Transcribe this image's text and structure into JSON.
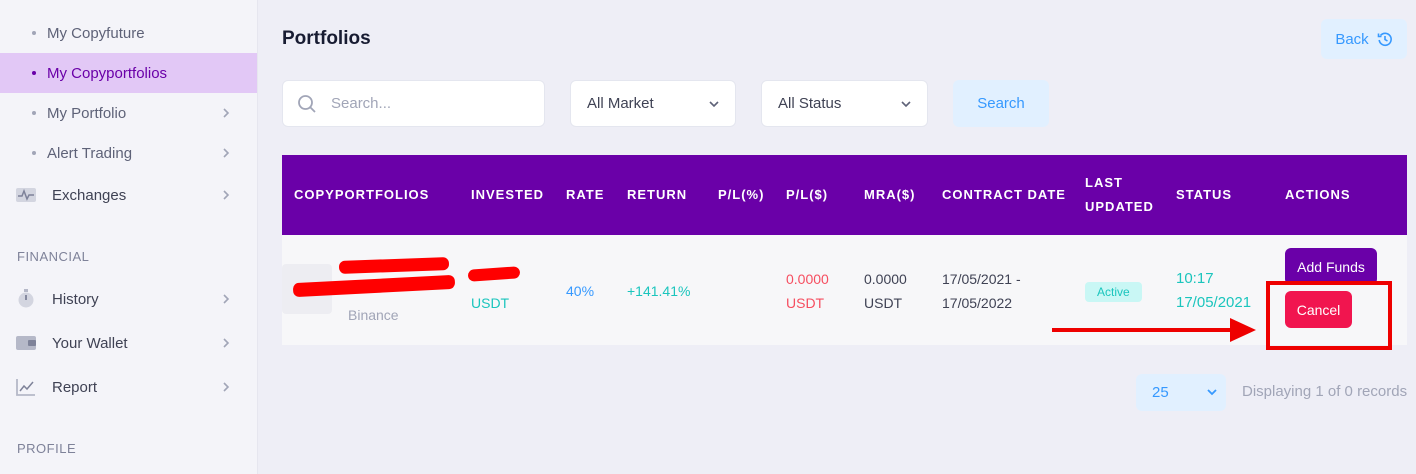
{
  "sidebar": {
    "sub_items": [
      {
        "label": "My Copyfuture"
      },
      {
        "label": "My Copyportfolios"
      },
      {
        "label": "My Portfolio"
      },
      {
        "label": "Alert Trading"
      }
    ],
    "exchanges": {
      "label": "Exchanges"
    },
    "financial": {
      "section_label": "FINANCIAL",
      "items": [
        {
          "label": "History"
        },
        {
          "label": "Your Wallet"
        },
        {
          "label": "Report"
        }
      ]
    },
    "profile_section_label": "PROFILE"
  },
  "main": {
    "title": "Portfolios",
    "back_label": "Back",
    "search_placeholder": "Search...",
    "market_filter": "All Market",
    "status_filter": "All Status",
    "search_button": "Search"
  },
  "table": {
    "headers": {
      "copyportfolios": "COPYPORTFOLIOS",
      "invested": "INVESTED",
      "rate": "RATE",
      "return": "RETURN",
      "pl_pct": "P/L(%)",
      "pl_usd": "P/L($)",
      "mra": "MRA($)",
      "contract_date": "CONTRACT DATE",
      "last_updated_1": "LAST",
      "last_updated_2": "UPDATED",
      "status": "STATUS",
      "actions": "ACTIONS"
    },
    "row": {
      "exchange": "Binance",
      "invested_unit": "USDT",
      "rate": "40%",
      "return": "+141.41%",
      "pl_usd_value": "0.0000",
      "pl_usd_unit": "USDT",
      "mra_value": "0.0000",
      "mra_unit": "USDT",
      "contract_start": "17/05/2021 -",
      "contract_end": "17/05/2022",
      "status_badge": "Active",
      "updated_time": "10:17",
      "updated_date": "17/05/2021",
      "add_funds_label": "Add Funds",
      "cancel_label": "Cancel"
    }
  },
  "footer": {
    "page_size": "25",
    "records_text": "Displaying 1 of 0 records"
  },
  "colors": {
    "accent_purple": "#6a00a8",
    "active_nav_bg": "#e2c8f6",
    "teal": "#1bc5bd",
    "blue": "#3699ff",
    "red_text": "#f64e60",
    "cancel_pink": "#f1154f",
    "annotation_red": "#ee0000"
  }
}
